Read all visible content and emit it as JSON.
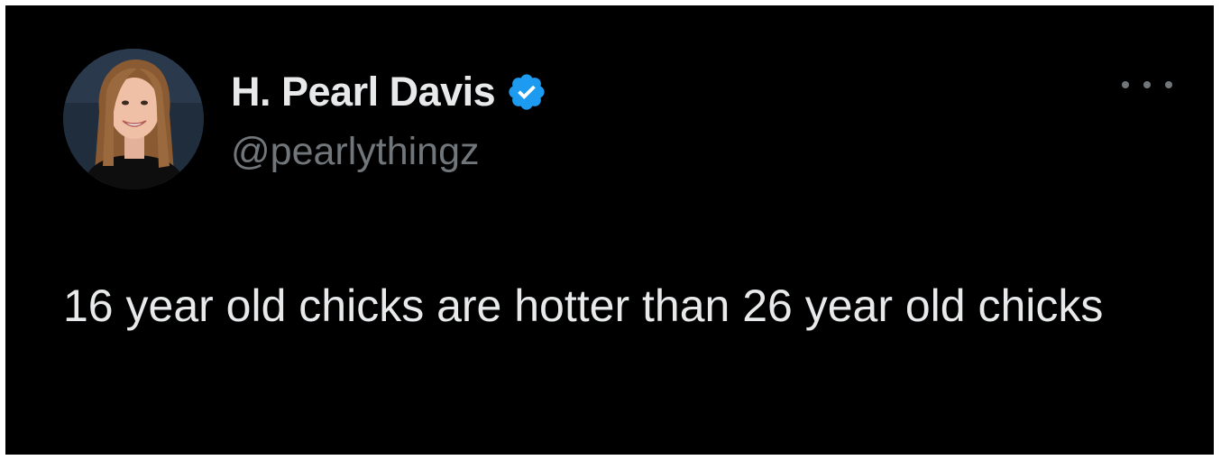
{
  "tweet": {
    "author": {
      "display_name": "H. Pearl Davis",
      "handle": "@pearlythingz",
      "verified": true,
      "avatar_icon": "profile-photo"
    },
    "text": "16 year old chicks are hotter than 26 year old chicks",
    "more_icon": "more-options-icon"
  },
  "colors": {
    "background": "#000000",
    "primary_text": "#e7e9ea",
    "secondary_text": "#71767b",
    "verified_badge": "#1d9bf0"
  }
}
